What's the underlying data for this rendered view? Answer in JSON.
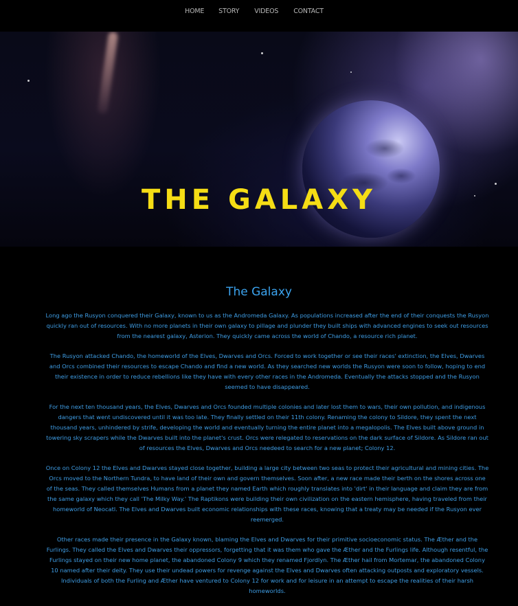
{
  "nav": {
    "items": [
      {
        "label": "HOME"
      },
      {
        "label": "STORY"
      },
      {
        "label": "VIDEOS"
      },
      {
        "label": "CONTACT"
      }
    ]
  },
  "hero": {
    "title": "THE GALAXY",
    "title_color": "#f5dd15"
  },
  "content": {
    "heading": "The Galaxy",
    "accent_color": "#3ba3ee",
    "paragraphs": [
      "Long ago the Rusyon conquered their Galaxy, known to us as the Andromeda Galaxy. As populations increased after the end of their conquests the Rusyon quickly ran out of resources. With no more planets in their own galaxy to pillage and plunder they built ships with advanced engines to seek out resources from the nearest galaxy, Asterion. They quickly came across the world of Chando, a resource rich planet.",
      "The Rusyon attacked Chando, the homeworld of the Elves, Dwarves and Orcs. Forced to work together or see their races' extinction, the Elves, Dwarves and Orcs combined their resources to escape Chando and find a new world. As they searched new worlds the Rusyon were soon to follow, hoping to end their existence in order to reduce rebellions like they have with every other races in the Andromeda. Eventually the attacks stopped and the Rusyon seemed to have disappeared.",
      "For the next ten thousand years, the Elves, Dwarves and Orcs founded multiple colonies and later lost them to wars, their own pollution, and indigenous dangers that went undiscovered until it was too late. They finally settled on their 11th colony. Renaming the colony to Sildore, they spent the next thousand years, unhindered by strife, developing the world and eventually turning the entire planet into a megalopolis. The Elves built above ground in towering sky scrapers while the Dwarves built into the planet's crust. Orcs were relegated to reservations on the dark surface of Sildore. As Sildore ran out of resources the Elves, Dwarves and Orcs needeed to search for a new planet; Colony 12.",
      "Once on Colony 12 the Elves and Dwarves stayed close together, building a large city between two seas to protect their agricultural and mining cities. The Orcs moved to the Northern Tundra, to have land of their own and govern themselves. Soon after, a new race made their berth on the shores across one of the seas. They called themselves Humans from a planet they named Earth which roughly translates into 'dirt' in their language and claim they are from the same galaxy which they call 'The Milky Way.' The Raptikons were building their own civilization on the eastern hemisphere, having traveled from their homeworld of Neocatl. The Elves and Dwarves built economic relationships with these races, knowing that a treaty may be needed if the Rusyon ever reemerged.",
      "Other races made their presence in the Galaxy known, blaming the Elves and Dwarves for their primitive socioeconomic status. The Æther and the Furlings. They called the Elves and Dwarves their oppressors, forgetting that it was them who gave the Æther and the Furlings life. Although resentful, the Furlings stayed on their new home planet, the abandoned Colony 9 which they renamed Fjordlyn. The Æther hail from Mortemar, the abandoned Colony 10 named after their deity. They use their undead powers for revenge against the Elves and Dwarves often attacking outposts and exploratory vessels. Individuals of both the Furling and Æther have ventured to Colony 12 for work and for leisure in an attempt to escape the realities of their harsh homeworlds."
    ]
  }
}
